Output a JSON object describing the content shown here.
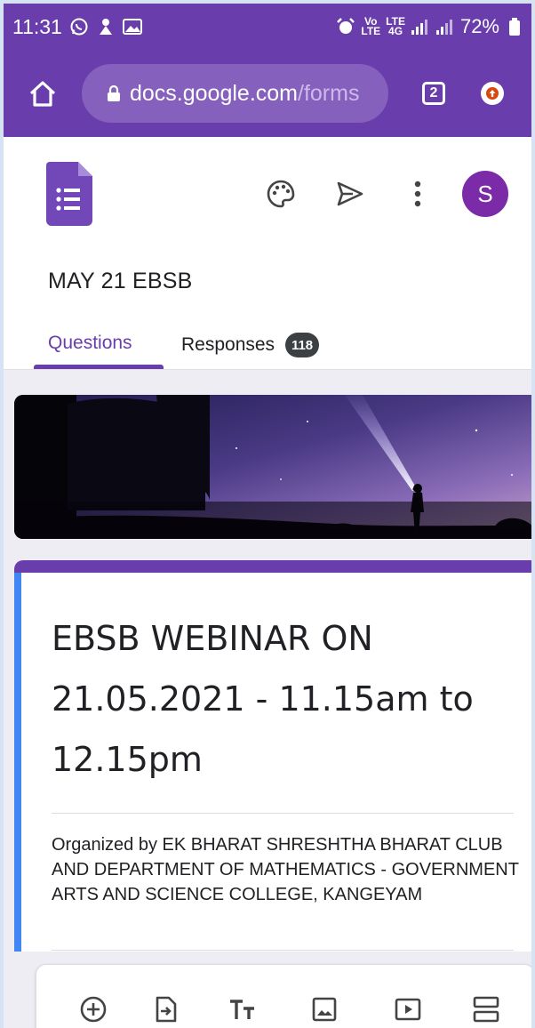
{
  "status_bar": {
    "time": "11:31",
    "battery_percent": "72%",
    "network_line1": "Vo",
    "network_line2": "LTE",
    "network2_line1": "LTE",
    "network2_line2": "4G"
  },
  "browser": {
    "url_host": "docs.google.com",
    "url_path": "/forms",
    "tab_count": "2"
  },
  "form_header": {
    "form_name": "MAY 21 EBSB",
    "avatar_letter": "S",
    "tabs": {
      "questions_label": "Questions",
      "responses_label": "Responses",
      "responses_count": "118"
    }
  },
  "form": {
    "title_lines": [
      "EBSB WEBINAR ON",
      "21.05.2021 - 11.15am to",
      "12.15pm"
    ],
    "description": "Organized by EK BHARAT SHRESHTHA BHARAT CLUB AND DEPARTMENT OF MATHEMATICS  - GOVERNMENT ARTS AND SCIENCE COLLEGE, KANGEYAM"
  },
  "colors": {
    "theme_purple": "#6a3dad",
    "accent_blue": "#4285f4",
    "avatar_purple": "#7b2aa8",
    "canvas_gray": "#efedf4"
  },
  "icons": {
    "header": [
      "palette-icon",
      "send-icon",
      "more-vert-icon"
    ],
    "toolbar": [
      "add-question-icon",
      "import-questions-icon",
      "add-title-icon",
      "add-image-icon",
      "add-video-icon",
      "add-section-icon"
    ]
  }
}
